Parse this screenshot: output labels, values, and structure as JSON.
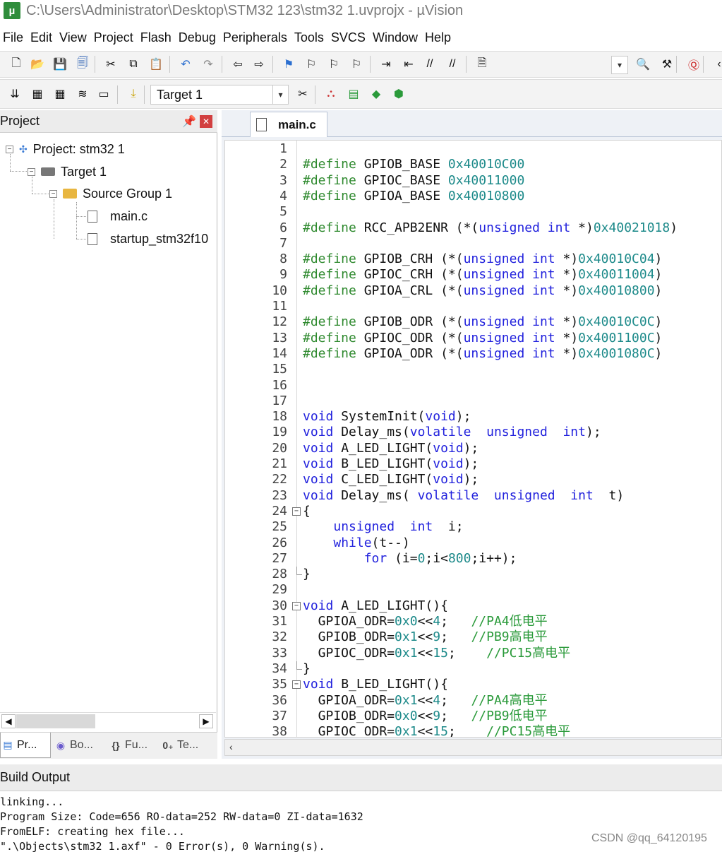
{
  "window": {
    "title": "C:\\Users\\Administrator\\Desktop\\STM32   123\\stm32 1.uvprojx - µVision"
  },
  "menu": [
    "File",
    "Edit",
    "View",
    "Project",
    "Flash",
    "Debug",
    "Peripherals",
    "Tools",
    "SVCS",
    "Window",
    "Help"
  ],
  "toolbar1": {
    "icons": [
      "new-file-icon",
      "open-file-icon",
      "save-icon",
      "save-all-icon",
      "cut-icon",
      "copy-icon",
      "paste-icon",
      "undo-icon",
      "redo-icon",
      "navigate-back-icon",
      "navigate-forward-icon",
      "insert-bookmark-icon",
      "previous-bookmark-icon",
      "next-bookmark-icon",
      "clear-bookmarks-icon",
      "indent-icon",
      "unindent-icon",
      "comment-icon",
      "uncomment-icon",
      "find-in-files-icon",
      "find-icon",
      "incremental-find-icon",
      "debug-session-icon",
      "more-icon"
    ]
  },
  "toolbar2": {
    "icons": [
      "translate-icon",
      "build-icon",
      "rebuild-icon",
      "batch-build-icon",
      "stop-build-icon",
      "download-icon",
      "target-options-icon",
      "manage-project-items-icon",
      "manage-rte-icon",
      "select-packs-icon",
      "pack-installer-icon"
    ],
    "target": "Target 1"
  },
  "project": {
    "title": "Project",
    "tree": [
      {
        "label": "Project: stm32 1"
      },
      {
        "label": "Target 1"
      },
      {
        "label": "Source Group 1"
      },
      {
        "label": "main.c"
      },
      {
        "label": "startup_stm32f10"
      }
    ],
    "tabs": [
      "Pr...",
      "Bo...",
      "Fu...",
      "Te..."
    ]
  },
  "editor": {
    "tab": "main.c",
    "lines": [
      [],
      [
        [
          "pp",
          "#define "
        ],
        [
          "",
          "GPIOB_BASE "
        ],
        [
          "num",
          "0x40010C00"
        ]
      ],
      [
        [
          "pp",
          "#define "
        ],
        [
          "",
          "GPIOC_BASE "
        ],
        [
          "num",
          "0x40011000"
        ]
      ],
      [
        [
          "pp",
          "#define "
        ],
        [
          "",
          "GPIOA_BASE "
        ],
        [
          "num",
          "0x40010800"
        ]
      ],
      [],
      [
        [
          "pp",
          "#define "
        ],
        [
          "",
          "RCC_APB2ENR (*("
        ],
        [
          "kw",
          "unsigned int "
        ],
        [
          "",
          "*)"
        ],
        [
          "num",
          "0x40021018"
        ],
        [
          "",
          ")"
        ]
      ],
      [],
      [
        [
          "pp",
          "#define "
        ],
        [
          "",
          "GPIOB_CRH (*("
        ],
        [
          "kw",
          "unsigned int "
        ],
        [
          "",
          "*)"
        ],
        [
          "num",
          "0x40010C04"
        ],
        [
          "",
          ")"
        ]
      ],
      [
        [
          "pp",
          "#define "
        ],
        [
          "",
          "GPIOC_CRH (*("
        ],
        [
          "kw",
          "unsigned int "
        ],
        [
          "",
          "*)"
        ],
        [
          "num",
          "0x40011004"
        ],
        [
          "",
          ")"
        ]
      ],
      [
        [
          "pp",
          "#define "
        ],
        [
          "",
          "GPIOA_CRL (*("
        ],
        [
          "kw",
          "unsigned int "
        ],
        [
          "",
          "*)"
        ],
        [
          "num",
          "0x40010800"
        ],
        [
          "",
          ")"
        ]
      ],
      [],
      [
        [
          "pp",
          "#define "
        ],
        [
          "",
          "GPIOB_ODR (*("
        ],
        [
          "kw",
          "unsigned int "
        ],
        [
          "",
          "*)"
        ],
        [
          "num",
          "0x40010C0C"
        ],
        [
          "",
          ")"
        ]
      ],
      [
        [
          "pp",
          "#define "
        ],
        [
          "",
          "GPIOC_ODR (*("
        ],
        [
          "kw",
          "unsigned int "
        ],
        [
          "",
          "*)"
        ],
        [
          "num",
          "0x4001100C"
        ],
        [
          "",
          ")"
        ]
      ],
      [
        [
          "pp",
          "#define "
        ],
        [
          "",
          "GPIOA_ODR (*("
        ],
        [
          "kw",
          "unsigned int "
        ],
        [
          "",
          "*)"
        ],
        [
          "num",
          "0x4001080C"
        ],
        [
          "",
          ")"
        ]
      ],
      [],
      [],
      [],
      [
        [
          "kw",
          "void "
        ],
        [
          "",
          "SystemInit("
        ],
        [
          "kw",
          "void"
        ],
        [
          "",
          ");"
        ]
      ],
      [
        [
          "kw",
          "void "
        ],
        [
          "",
          "Delay_ms("
        ],
        [
          "kw",
          "volatile  unsigned  int"
        ],
        [
          "",
          ");"
        ]
      ],
      [
        [
          "kw",
          "void "
        ],
        [
          "",
          "A_LED_LIGHT("
        ],
        [
          "kw",
          "void"
        ],
        [
          "",
          ");"
        ]
      ],
      [
        [
          "kw",
          "void "
        ],
        [
          "",
          "B_LED_LIGHT("
        ],
        [
          "kw",
          "void"
        ],
        [
          "",
          ");"
        ]
      ],
      [
        [
          "kw",
          "void "
        ],
        [
          "",
          "C_LED_LIGHT("
        ],
        [
          "kw",
          "void"
        ],
        [
          "",
          ");"
        ]
      ],
      [
        [
          "kw",
          "void "
        ],
        [
          "",
          "Delay_ms( "
        ],
        [
          "kw",
          "volatile  unsigned  int  "
        ],
        [
          "",
          "t)"
        ]
      ],
      [
        [
          "",
          "{"
        ]
      ],
      [
        [
          "",
          "    "
        ],
        [
          "kw",
          "unsigned  int  "
        ],
        [
          "",
          "i;"
        ]
      ],
      [
        [
          "",
          "    "
        ],
        [
          "kw",
          "while"
        ],
        [
          "",
          "(t--)"
        ]
      ],
      [
        [
          "",
          "        "
        ],
        [
          "kw",
          "for "
        ],
        [
          "",
          "(i="
        ],
        [
          "num",
          "0"
        ],
        [
          "",
          ";i<"
        ],
        [
          "num",
          "800"
        ],
        [
          "",
          ";i++);"
        ]
      ],
      [
        [
          "",
          "}"
        ]
      ],
      [],
      [
        [
          "kw",
          "void "
        ],
        [
          "",
          "A_LED_LIGHT(){"
        ]
      ],
      [
        [
          "",
          "  GPIOA_ODR="
        ],
        [
          "num",
          "0x0"
        ],
        [
          "",
          "<<"
        ],
        [
          "num",
          "4"
        ],
        [
          "",
          ";   "
        ],
        [
          "cm",
          "//PA4低电平"
        ]
      ],
      [
        [
          "",
          "  GPIOB_ODR="
        ],
        [
          "num",
          "0x1"
        ],
        [
          "",
          "<<"
        ],
        [
          "num",
          "9"
        ],
        [
          "",
          ";   "
        ],
        [
          "cm",
          "//PB9高电平"
        ]
      ],
      [
        [
          "",
          "  GPIOC_ODR="
        ],
        [
          "num",
          "0x1"
        ],
        [
          "",
          "<<"
        ],
        [
          "num",
          "15"
        ],
        [
          "",
          ";    "
        ],
        [
          "cm",
          "//PC15高电平"
        ]
      ],
      [
        [
          "",
          "}"
        ]
      ],
      [
        [
          "kw",
          "void "
        ],
        [
          "",
          "B_LED_LIGHT(){"
        ]
      ],
      [
        [
          "",
          "  GPIOA_ODR="
        ],
        [
          "num",
          "0x1"
        ],
        [
          "",
          "<<"
        ],
        [
          "num",
          "4"
        ],
        [
          "",
          ";   "
        ],
        [
          "cm",
          "//PA4高电平"
        ]
      ],
      [
        [
          "",
          "  GPIOB_ODR="
        ],
        [
          "num",
          "0x0"
        ],
        [
          "",
          "<<"
        ],
        [
          "num",
          "9"
        ],
        [
          "",
          ";   "
        ],
        [
          "cm",
          "//PB9低电平"
        ]
      ],
      [
        [
          "",
          "  GPIOC_ODR="
        ],
        [
          "num",
          "0x1"
        ],
        [
          "",
          "<<"
        ],
        [
          "num",
          "15"
        ],
        [
          "",
          ";    "
        ],
        [
          "cm",
          "//PC15高电平"
        ]
      ]
    ]
  },
  "build_output": {
    "title": "Build Output",
    "lines": [
      "linking...",
      "Program Size: Code=656 RO-data=252 RW-data=0 ZI-data=1632",
      "FromELF: creating hex file...",
      "\".\\Objects\\stm32 1.axf\" - 0 Error(s), 0 Warning(s)."
    ]
  },
  "watermark": "CSDN @qq_64120195"
}
